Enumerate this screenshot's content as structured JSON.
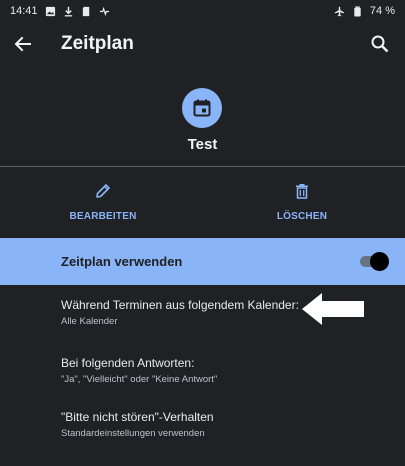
{
  "status": {
    "time": "14:41",
    "battery": "74 %"
  },
  "toolbar": {
    "title": "Zeitplan"
  },
  "schedule": {
    "name": "Test"
  },
  "actions": {
    "edit_label": "BEARBEITEN",
    "delete_label": "LÖSCHEN"
  },
  "toggle": {
    "label": "Zeitplan verwenden",
    "enabled": true
  },
  "settings": [
    {
      "title": "Während Terminen aus folgendem Kalender:",
      "subtitle": "Alle Kalender"
    },
    {
      "title": "Bei folgenden Antworten:",
      "subtitle": "\"Ja\", \"Vielleicht\" oder \"Keine Antwort\""
    },
    {
      "title": "\"Bitte nicht stören\"-Verhalten",
      "subtitle": "Standardeinstellungen verwenden"
    }
  ],
  "colors": {
    "background": "#202124",
    "accent": "#8ab4f8",
    "text": "#e8eaed"
  }
}
